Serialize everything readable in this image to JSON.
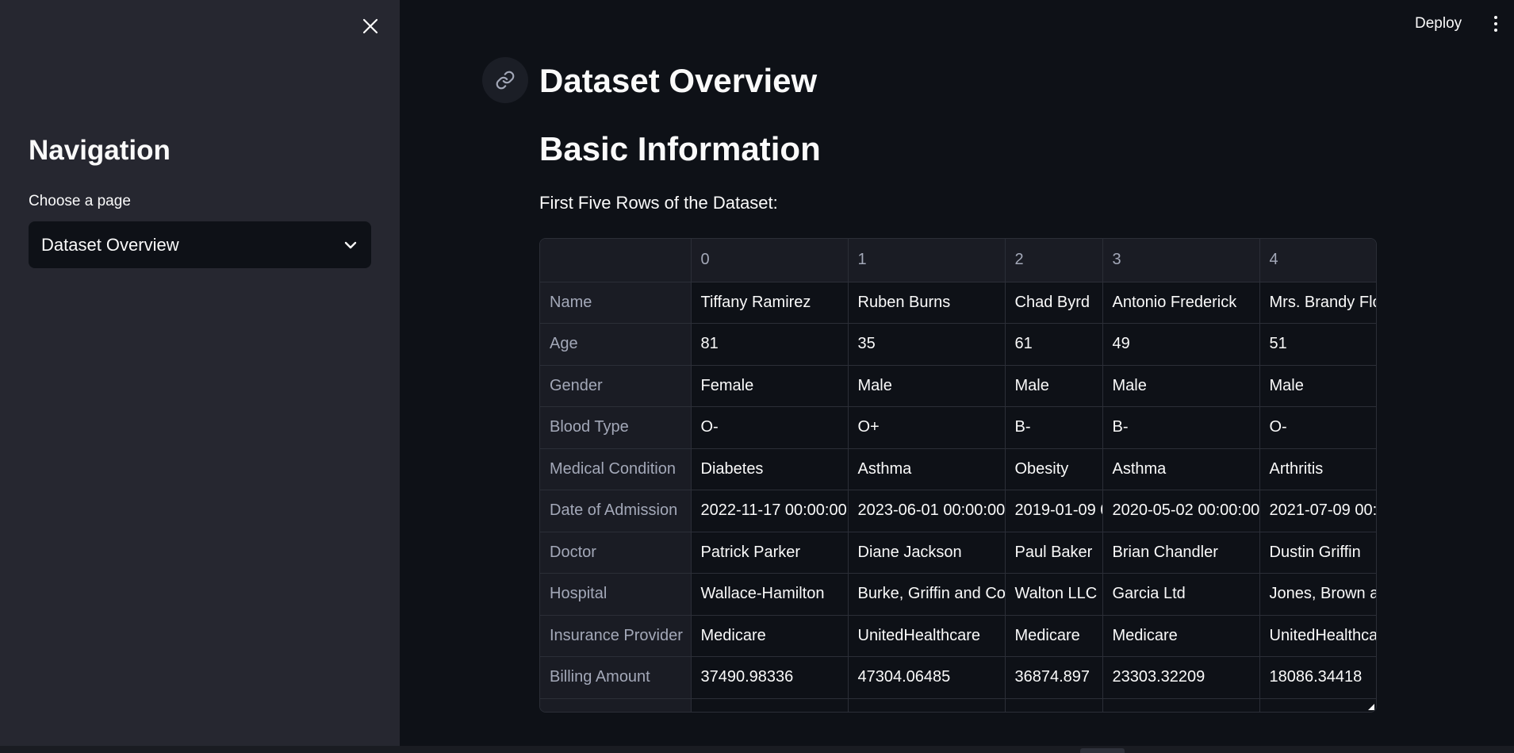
{
  "sidebar": {
    "title": "Navigation",
    "select_label": "Choose a page",
    "selected_page": "Dataset Overview"
  },
  "header": {
    "deploy_label": "Deploy"
  },
  "main": {
    "title": "Dataset Overview",
    "subtitle": "Basic Information",
    "table_caption": "First Five Rows of the Dataset:",
    "table": {
      "columns": [
        "",
        "0",
        "1",
        "2",
        "3",
        "4"
      ],
      "rows": [
        {
          "label": "Name",
          "cells": [
            "Tiffany Ramirez",
            "Ruben Burns",
            "Chad Byrd",
            "Antonio Frederick",
            "Mrs. Brandy Flo"
          ]
        },
        {
          "label": "Age",
          "cells": [
            "81",
            "35",
            "61",
            "49",
            "51"
          ]
        },
        {
          "label": "Gender",
          "cells": [
            "Female",
            "Male",
            "Male",
            "Male",
            "Male"
          ]
        },
        {
          "label": "Blood Type",
          "cells": [
            "O-",
            "O+",
            "B-",
            "B-",
            "O-"
          ]
        },
        {
          "label": "Medical Condition",
          "cells": [
            "Diabetes",
            "Asthma",
            "Obesity",
            "Asthma",
            "Arthritis"
          ]
        },
        {
          "label": "Date of Admission",
          "cells": [
            "2022-11-17 00:00:00",
            "2023-06-01 00:00:00",
            "2019-01-09 0",
            "2020-05-02 00:00:00",
            "2021-07-09 00:0"
          ]
        },
        {
          "label": "Doctor",
          "cells": [
            "Patrick Parker",
            "Diane Jackson",
            "Paul Baker",
            "Brian Chandler",
            "Dustin Griffin"
          ]
        },
        {
          "label": "Hospital",
          "cells": [
            "Wallace-Hamilton",
            "Burke, Griffin and Coo",
            "Walton LLC",
            "Garcia Ltd",
            "Jones, Brown a"
          ]
        },
        {
          "label": "Insurance Provider",
          "cells": [
            "Medicare",
            "UnitedHealthcare",
            "Medicare",
            "Medicare",
            "UnitedHealthca"
          ]
        },
        {
          "label": "Billing Amount",
          "cells": [
            "37490.98336",
            "47304.06485",
            "36874.897",
            "23303.32209",
            "18086.34418"
          ]
        },
        {
          "label": "",
          "cells": [
            "",
            "",
            "",
            "",
            ""
          ]
        }
      ]
    }
  },
  "colors": {
    "sidebar_bg": "#262730",
    "main_bg": "#0e1117",
    "text": "#fafafa",
    "header_text": "#a3a8b8",
    "border": "#2b2e37"
  },
  "icons": [
    "close-icon",
    "chevron-down-icon",
    "link-icon",
    "kebab-menu-icon"
  ]
}
